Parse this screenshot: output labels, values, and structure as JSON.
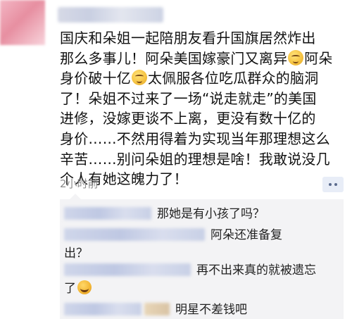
{
  "post": {
    "lines": [
      "国庆和朵姐一起陪朋友看升国旗居然炸出",
      "那么多事儿！阿朵美国嫁豪门又离异",
      "阿朵",
      "身价破十亿",
      "太佩服各位吃瓜群众的脑洞",
      "了！朵姐不过来了一场“说走就走”的美国",
      "进修，没嫁更谈不上离，更没有数十亿的",
      "身价……不然用得着为实现当年那理想这么",
      "辛苦……别问朵姐的理想是啥！我敢说没几",
      "个人有她这魄力了！"
    ],
    "emoji_icon": "grin-emoji-icon"
  },
  "time": "2小时前",
  "more_button_icon": "more-dots-icon",
  "comments": [
    {
      "text": "那她是有小孩了吗？"
    },
    {
      "text_line1": "阿朵还准备复",
      "text_line2": "出？"
    },
    {
      "text_line1": "再不出来真的就被遗忘",
      "text_line2": "了",
      "emoji_icon": "laugh-cry-emoji-icon"
    },
    {
      "text": "明星不差钱吧"
    }
  ]
}
